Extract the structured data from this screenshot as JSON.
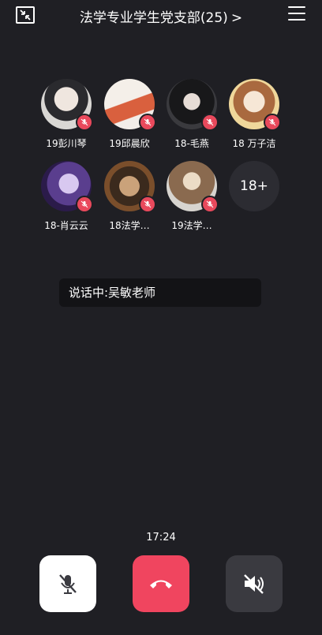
{
  "header": {
    "title": "法学专业学生党支部(25)",
    "chevron": ">"
  },
  "members": [
    {
      "name": "19彭川琴"
    },
    {
      "name": "19邱晨欣"
    },
    {
      "name": "18-毛燕"
    },
    {
      "name": "18 万子洁"
    },
    {
      "name": "18-肖云云"
    },
    {
      "name": "18法学…"
    },
    {
      "name": "19法学…"
    }
  ],
  "more_count": "18+",
  "speaking": {
    "label": "说话中:吴敏老师"
  },
  "call": {
    "duration": "17:24"
  },
  "colors": {
    "background": "#1f1f24",
    "muted_badge": "#e9495c",
    "hangup": "#f0455f"
  }
}
